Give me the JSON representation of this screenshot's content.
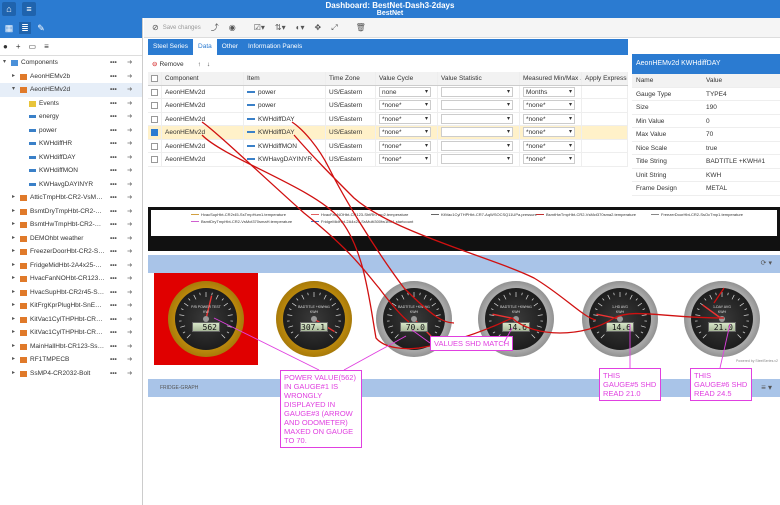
{
  "topbar": {
    "title": "Dashboard: BestNet-Dash3-2days",
    "subtitle": "BestNet"
  },
  "left_panel": {
    "tree": [
      {
        "label": "Components",
        "indent": 0,
        "type": "folder"
      },
      {
        "label": "AeonHEMv2b",
        "indent": 1,
        "type": "comp"
      },
      {
        "label": "AeonHEMv2d",
        "indent": 1,
        "type": "comp",
        "selected": true
      },
      {
        "label": "Events",
        "indent": 2,
        "type": "events"
      },
      {
        "label": "energy",
        "indent": 2,
        "type": "item"
      },
      {
        "label": "power",
        "indent": 2,
        "type": "item"
      },
      {
        "label": "KWHdiffHR",
        "indent": 2,
        "type": "item"
      },
      {
        "label": "KWHdiffDAY",
        "indent": 2,
        "type": "item"
      },
      {
        "label": "KWHdiffMON",
        "indent": 2,
        "type": "item"
      },
      {
        "label": "KWHavgDAYINYR",
        "indent": 2,
        "type": "item"
      },
      {
        "label": "AtticTmpHbt-CR2-VsMct370s...",
        "indent": 1,
        "type": "comp"
      },
      {
        "label": "BsmtDryTmpHbt-CR2-VsMct...",
        "indent": 1,
        "type": "comp"
      },
      {
        "label": "BsmtHwTmpHbt-CR2-VsMct3...",
        "indent": 1,
        "type": "comp"
      },
      {
        "label": "DEMOhbt weather",
        "indent": 1,
        "type": "comp"
      },
      {
        "label": "FreezerDoorHbt-CR2-SsOcT...",
        "indent": 1,
        "type": "comp"
      },
      {
        "label": "FridgeMidHbt-2A4x25-SsMulti2",
        "indent": 1,
        "type": "comp"
      },
      {
        "label": "HvacFanNOHbt-CR123-ShtR...",
        "indent": 1,
        "type": "comp"
      },
      {
        "label": "HvacSupHbt-CR2r45-SsTmp...",
        "indent": 1,
        "type": "comp"
      },
      {
        "label": "KitFrgKprPlugHbt-SnE1cnb7A",
        "indent": 1,
        "type": "comp"
      },
      {
        "label": "KitVac1CylTHPHbt-CR7-AqW...",
        "indent": 1,
        "type": "comp"
      },
      {
        "label": "KitVac1CylTHPHbt-CR7-AqWS...",
        "indent": 1,
        "type": "comp"
      },
      {
        "label": "MainHallHbt-CR123-SsMoTmp2",
        "indent": 1,
        "type": "comp"
      },
      {
        "label": "RF1TMPECB",
        "indent": 1,
        "type": "comp"
      },
      {
        "label": "SsMP4-CR2032-Bolt",
        "indent": 1,
        "type": "comp"
      }
    ]
  },
  "toolbar": {
    "save": "Save changes"
  },
  "tabs": [
    "Steel Series",
    "Data",
    "Other",
    "Information Panels"
  ],
  "active_tab": "Data",
  "grid_toolbar": {
    "remove": "Remove"
  },
  "grid": {
    "columns": [
      "",
      "Component",
      "Item",
      "Time Zone",
      "Value Cycle",
      "Value Statistic",
      "Measured Min/Max ...",
      "Apply Expressi"
    ],
    "rows": [
      {
        "checked": false,
        "component": "AeonHEMv2d",
        "item": "power",
        "tz": "US/Eastern",
        "cycle": "none",
        "stat": "",
        "minmax": "Months"
      },
      {
        "checked": false,
        "component": "AeonHEMv2d",
        "item": "power",
        "tz": "US/Eastern",
        "cycle": "*none*",
        "stat": "",
        "minmax": "*none*"
      },
      {
        "checked": false,
        "component": "AeonHEMv2d",
        "item": "KWHdiffDAY",
        "tz": "US/Eastern",
        "cycle": "*none*",
        "stat": "",
        "minmax": "*none*"
      },
      {
        "checked": true,
        "component": "AeonHEMv2d",
        "item": "KWHdiffDAY",
        "tz": "US/Eastern",
        "cycle": "*none*",
        "stat": "",
        "minmax": "*none*"
      },
      {
        "checked": false,
        "component": "AeonHEMv2d",
        "item": "KWHdiffMON",
        "tz": "US/Eastern",
        "cycle": "*none*",
        "stat": "",
        "minmax": "*none*"
      },
      {
        "checked": false,
        "component": "AeonHEMv2d",
        "item": "KWHavgDAYINYR",
        "tz": "US/Eastern",
        "cycle": "*none*",
        "stat": "",
        "minmax": "*none*"
      }
    ]
  },
  "props": {
    "header": "AeonHEMv2d KWHdiffDAY",
    "columns": [
      "Name",
      "Value"
    ],
    "rows": [
      [
        "Gauge Type",
        "TYPE4"
      ],
      [
        "Size",
        "190"
      ],
      [
        "Min Value",
        "0"
      ],
      [
        "Max Value",
        "70"
      ],
      [
        "Nice Scale",
        "true"
      ],
      [
        "Title String",
        "BADTITLE +KWH#1"
      ],
      [
        "Unit String",
        "KWH"
      ],
      [
        "Frame Design",
        "METAL"
      ]
    ]
  },
  "legend": [
    {
      "label": "HvacSupHbt-CR2r45-SsTmpHum1.temperature",
      "color": "#d2a040"
    },
    {
      "label": "HvacFanNOHbt-CR123-ShtRhTmp2.temperature",
      "color": "#e06060"
    },
    {
      "label": "KitVac1CylTHPHbt-CR7-AqWSOCSQ11UPa.pressure",
      "color": "#666666"
    },
    {
      "label": "BsmtHwTmpHbt-CR2-VsMct370sma2.temperature",
      "color": "#c03030"
    },
    {
      "label": "FreezerDoorHbt-CR2-SsOcTmp1.temperature",
      "color": "#888888"
    },
    {
      "label": "BsmtDryTmpHbt-CR2-VsMct370smaH.temperature",
      "color": "#d060d0"
    },
    {
      "label": "FridgeMidHbt-2A4x25-SsMulti300fw1bD1.startcount",
      "color": "#4070c0"
    }
  ],
  "gauges": [
    {
      "title": "P/B POWER TEST",
      "unit": "KW",
      "value": "562",
      "style": "gold",
      "needle": 0.55
    },
    {
      "title": "BADTITLE +KWH#1",
      "unit": "KWH",
      "value": "307.1",
      "style": "gold",
      "needle": 0.95
    },
    {
      "title": "BADTITLE +KWH#1",
      "unit": "KWH",
      "value": "70.0",
      "style": "metal",
      "needle": 1.0
    },
    {
      "title": "BADTITLE +KWH#1",
      "unit": "KWH",
      "value": "14.6",
      "style": "metal",
      "needle": 0.21
    },
    {
      "title": "1-HD AVG",
      "unit": "KWH",
      "value": "14.6",
      "style": "metal",
      "needle": 0.21
    },
    {
      "title": "1-DAY AVG",
      "unit": "KWH",
      "value": "21.0",
      "style": "metal",
      "needle": 0.3
    }
  ],
  "dash_extra": {
    "fridge": "FRIDGE-GRAPH",
    "powered": "Powered by SteelSeries.v2"
  },
  "annotations": {
    "values_match": "VALUES SHD MATCH",
    "power_note": "POWER VALUE(562) IN GAUGE#1 IS WRONGLY DISPLAYED IN GAUGE#3 (ARROW AND ODOMETER) MAXED ON GAUGE TO 70.",
    "gauge5": "THIS GAUGE#5 SHD READ 21.0",
    "gauge6": "THIS GAUGE#6 SHD READ 24.5"
  },
  "colors": {
    "accent": "#2b7bd1",
    "annotation": "#e040e0",
    "arrow_red": "#d01010",
    "highlight_row": "#fff1c9"
  }
}
